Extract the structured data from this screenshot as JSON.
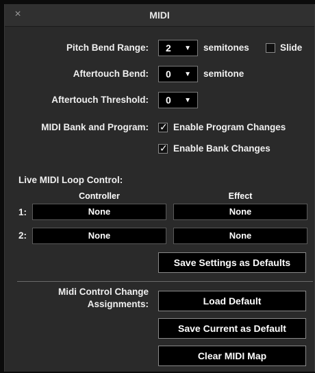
{
  "window": {
    "title": "MIDI",
    "close_glyph": "×"
  },
  "pitch_bend": {
    "label": "Pitch Bend Range:",
    "value": "2",
    "unit": "semitones",
    "slide_label": "Slide",
    "slide_checked": false
  },
  "aftertouch_bend": {
    "label": "Aftertouch Bend:",
    "value": "0",
    "unit": "semitone"
  },
  "aftertouch_threshold": {
    "label": "Aftertouch Threshold:",
    "value": "0"
  },
  "bank_program": {
    "label": "MIDI Bank and Program:",
    "program_changes_label": "Enable Program Changes",
    "program_changes_checked": true,
    "bank_changes_label": "Enable Bank Changes",
    "bank_changes_checked": true
  },
  "loop_control": {
    "label": "Live MIDI Loop Control:",
    "col_controller": "Controller",
    "col_effect": "Effect",
    "rows": [
      {
        "num": "1:",
        "controller": "None",
        "effect": "None"
      },
      {
        "num": "2:",
        "controller": "None",
        "effect": "None"
      }
    ]
  },
  "buttons": {
    "save_defaults": "Save Settings as Defaults",
    "load_default": "Load Default",
    "save_current_default": "Save Current as Default",
    "clear_map": "Clear MIDI Map"
  },
  "cc_assign": {
    "label_line1": "Midi Control Change",
    "label_line2": "Assignments:"
  },
  "icons": {
    "dropdown": "▼",
    "check": "✓"
  }
}
